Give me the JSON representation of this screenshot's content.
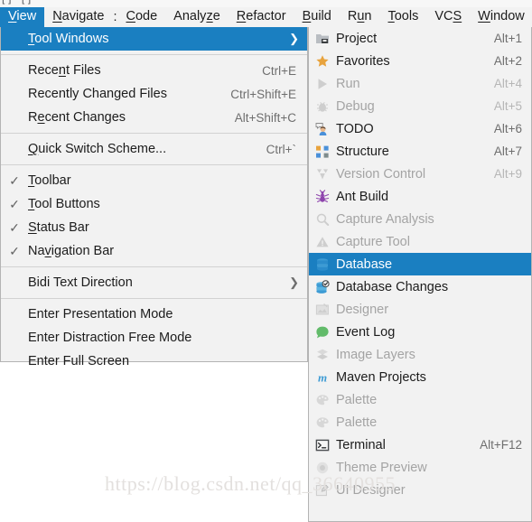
{
  "window": {
    "ghost_title": "[            ] - [           ]"
  },
  "menubar": {
    "items": [
      {
        "label": "View",
        "mnemonic": "V",
        "active": true
      },
      {
        "label": "Navigate",
        "mnemonic": "N",
        "active": false
      },
      {
        "label": ":",
        "mnemonic": "",
        "active": false,
        "separator": true
      },
      {
        "label": "Code",
        "mnemonic": "C",
        "active": false
      },
      {
        "label": "Analyze",
        "mnemonic": "z",
        "active": false
      },
      {
        "label": "Refactor",
        "mnemonic": "R",
        "active": false
      },
      {
        "label": "Build",
        "mnemonic": "B",
        "active": false
      },
      {
        "label": "Run",
        "mnemonic": "u",
        "active": false
      },
      {
        "label": "Tools",
        "mnemonic": "T",
        "active": false
      },
      {
        "label": "VCS",
        "mnemonic": "S",
        "active": false
      },
      {
        "label": "Window",
        "mnemonic": "W",
        "active": false
      }
    ]
  },
  "view_menu": {
    "items": [
      {
        "label": "Tool Windows",
        "mnemonic": "T",
        "accel": "",
        "checked": false,
        "highlight": true,
        "submenu": true
      },
      {
        "separator": true
      },
      {
        "label": "Recent Files",
        "mnemonic": "n",
        "accel": "Ctrl+E",
        "checked": false
      },
      {
        "label": "Recently Changed Files",
        "mnemonic": "",
        "accel": "Ctrl+Shift+E",
        "checked": false
      },
      {
        "label": "Recent Changes",
        "mnemonic": "e",
        "accel": "Alt+Shift+C",
        "checked": false
      },
      {
        "separator": true
      },
      {
        "label": "Quick Switch Scheme...",
        "mnemonic": "Q",
        "accel": "Ctrl+`",
        "checked": false
      },
      {
        "separator": true
      },
      {
        "label": "Toolbar",
        "mnemonic": "T",
        "accel": "",
        "checked": true
      },
      {
        "label": "Tool Buttons",
        "mnemonic": "T",
        "accel": "",
        "checked": true
      },
      {
        "label": "Status Bar",
        "mnemonic": "S",
        "accel": "",
        "checked": true
      },
      {
        "label": "Navigation Bar",
        "mnemonic": "v",
        "accel": "",
        "checked": true
      },
      {
        "separator": true
      },
      {
        "label": "Bidi Text Direction",
        "mnemonic": "",
        "accel": "",
        "checked": false,
        "submenu": true
      },
      {
        "separator": true
      },
      {
        "label": "Enter Presentation Mode",
        "mnemonic": "",
        "accel": "",
        "checked": false
      },
      {
        "label": "Enter Distraction Free Mode",
        "mnemonic": "",
        "accel": "",
        "checked": false
      },
      {
        "label": "Enter Full Screen",
        "mnemonic": "",
        "accel": "",
        "checked": false
      }
    ],
    "submenu_arrow": "❯",
    "check_glyph": "✓"
  },
  "tool_windows_menu": {
    "items": [
      {
        "label": "Project",
        "accel": "Alt+1",
        "icon": "project-icon",
        "disabled": false,
        "selected": false
      },
      {
        "label": "Favorites",
        "accel": "Alt+2",
        "icon": "star-icon",
        "disabled": false,
        "selected": false
      },
      {
        "label": "Run",
        "accel": "Alt+4",
        "icon": "run-play-icon",
        "disabled": true,
        "selected": false
      },
      {
        "label": "Debug",
        "accel": "Alt+5",
        "icon": "debug-bug-icon",
        "disabled": true,
        "selected": false
      },
      {
        "label": "TODO",
        "accel": "Alt+6",
        "icon": "todo-person-icon",
        "disabled": false,
        "selected": false
      },
      {
        "label": "Structure",
        "accel": "Alt+7",
        "icon": "structure-icon",
        "disabled": false,
        "selected": false
      },
      {
        "label": "Version Control",
        "accel": "Alt+9",
        "icon": "version-control-icon",
        "disabled": true,
        "selected": false
      },
      {
        "label": "Ant Build",
        "accel": "",
        "icon": "ant-icon",
        "disabled": false,
        "selected": false
      },
      {
        "label": "Capture Analysis",
        "accel": "",
        "icon": "magnifier-icon",
        "disabled": true,
        "selected": false
      },
      {
        "label": "Capture Tool",
        "accel": "",
        "icon": "warning-triangle-icon",
        "disabled": true,
        "selected": false
      },
      {
        "label": "Database",
        "accel": "",
        "icon": "database-icon",
        "disabled": false,
        "selected": true
      },
      {
        "label": "Database Changes",
        "accel": "",
        "icon": "database-changes-icon",
        "disabled": false,
        "selected": false
      },
      {
        "label": "Designer",
        "accel": "",
        "icon": "designer-icon",
        "disabled": true,
        "selected": false
      },
      {
        "label": "Event Log",
        "accel": "",
        "icon": "event-log-icon",
        "disabled": false,
        "selected": false
      },
      {
        "label": "Image Layers",
        "accel": "",
        "icon": "image-layers-icon",
        "disabled": true,
        "selected": false
      },
      {
        "label": "Maven Projects",
        "accel": "",
        "icon": "maven-icon",
        "disabled": false,
        "selected": false
      },
      {
        "label": "Palette",
        "accel": "",
        "icon": "palette-icon",
        "disabled": true,
        "selected": false
      },
      {
        "label": "Palette",
        "accel": "",
        "icon": "palette-icon",
        "disabled": true,
        "selected": false
      },
      {
        "label": "Terminal",
        "accel": "Alt+F12",
        "icon": "terminal-icon",
        "disabled": false,
        "selected": false
      },
      {
        "label": "Theme Preview",
        "accel": "",
        "icon": "theme-preview-icon",
        "disabled": true,
        "selected": false
      },
      {
        "label": "UI Designer",
        "accel": "",
        "icon": "ui-designer-icon",
        "disabled": true,
        "selected": false
      }
    ]
  },
  "watermark": {
    "text": "https://blog.csdn.net/qq_36640955"
  },
  "colors": {
    "accent_blue": "#1a7fc1",
    "menu_bg": "#f2f2f2",
    "menu_border": "#b4b4b4",
    "text": "#1c1c1c",
    "disabled_text": "#a4a4a4",
    "accel_text": "#6e6e6e"
  }
}
